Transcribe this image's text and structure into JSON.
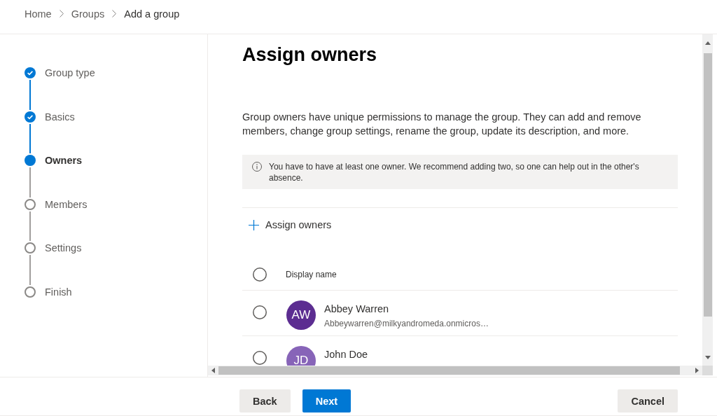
{
  "breadcrumb": [
    {
      "label": "Home",
      "current": false
    },
    {
      "label": "Groups",
      "current": false
    },
    {
      "label": "Add a group",
      "current": true
    }
  ],
  "steps": [
    {
      "label": "Group type",
      "completed": true,
      "selected": false
    },
    {
      "label": "Basics",
      "completed": true,
      "selected": false
    },
    {
      "label": "Owners",
      "completed": false,
      "selected": true
    },
    {
      "label": "Members",
      "completed": false,
      "selected": false
    },
    {
      "label": "Settings",
      "completed": false,
      "selected": false
    },
    {
      "label": "Finish",
      "completed": false,
      "selected": false
    }
  ],
  "page": {
    "title": "Assign owners",
    "description": "Group owners have unique permissions to manage the group. They can add and remove members, change group settings, rename the group, update its description, and more.",
    "info": "You have to have at least one owner. We recommend adding two, so one can help out in the other's absence.",
    "assign_button": "Assign owners"
  },
  "owners_list": {
    "header": {
      "label": "Display name",
      "selected": false
    },
    "rows": [
      {
        "initials": "AW",
        "name": "Abbey Warren",
        "email": "Abbeywarren@milkyandromeda.onmicros…",
        "color": "#5c2d91",
        "selected": false
      },
      {
        "initials": "JD",
        "name": "John Doe",
        "color": "#8764b8",
        "selected": false
      }
    ]
  },
  "footer": {
    "left_buttons": [
      {
        "label": "Back",
        "kind": "secondary"
      },
      {
        "label": "Next",
        "kind": "primary"
      }
    ],
    "right_buttons": [
      {
        "label": "Cancel",
        "kind": "secondary"
      }
    ]
  }
}
